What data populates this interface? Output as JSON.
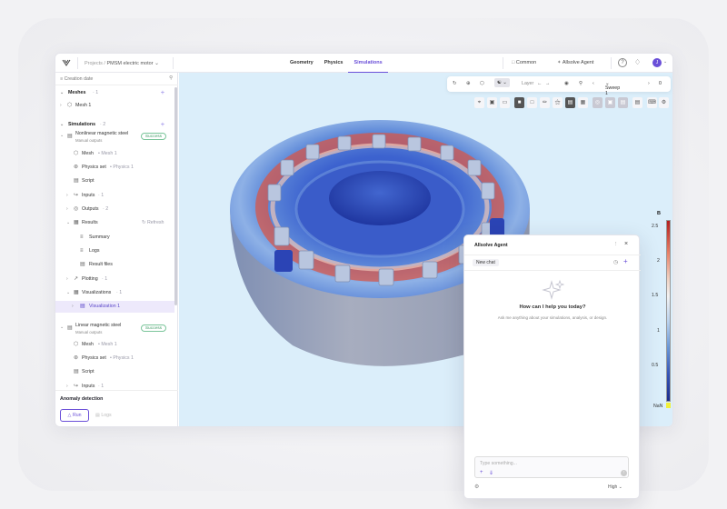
{
  "topbar": {
    "breadcrumb_root": "Projects",
    "breadcrumb_sep": "/",
    "project_name": "PMSM electric motor",
    "tabs": [
      {
        "label": "Geometry"
      },
      {
        "label": "Physics"
      },
      {
        "label": "Simulations"
      }
    ],
    "common_label": "Common",
    "agent_label": "Allsolve Agent",
    "help_icon": "help-circle-icon",
    "bell_icon": "bell-icon",
    "avatar_letter": "J"
  },
  "sidebar": {
    "filter_label": "Creation date",
    "meshes_label": "Meshes",
    "meshes_count": "· 1",
    "mesh_item": "Mesh 1",
    "simulations_label": "Simulations",
    "simulations_count": "· 2",
    "sim1": {
      "name": "Nonlinear magnetic steel",
      "subtitle": "Manual outputs",
      "status": "Success",
      "mesh_label": "Mesh",
      "mesh_ref": "Mesh 1",
      "physics_label": "Physics set",
      "physics_ref": "Physics 1",
      "script_label": "Script",
      "inputs_label": "Inputs",
      "inputs_count": "· 1",
      "outputs_label": "Outputs",
      "outputs_count": "· 2",
      "results_label": "Results",
      "refresh_label": "Refresh",
      "summary_label": "Summary",
      "logs_label": "Logs",
      "result_files_label": "Result files",
      "plotting_label": "Plotting",
      "plotting_count": "· 1",
      "visualizations_label": "Visualizations",
      "visualizations_count": "· 1",
      "visualization_item": "Visualization 1"
    },
    "sim2": {
      "name": "Linear magnetic steel",
      "subtitle": "Manual outputs",
      "status": "Success",
      "mesh_label": "Mesh",
      "mesh_ref": "Mesh 1",
      "physics_label": "Physics set",
      "physics_ref": "Physics 1",
      "script_label": "Script",
      "inputs_label": "Inputs",
      "inputs_count": "· 1"
    },
    "anomaly_title": "Anomaly detection",
    "run_label": "Run",
    "logs_button_label": "Logs"
  },
  "viewport": {
    "toolbar": {
      "layer_label": "Layer",
      "sweep_label": "Sweep 1",
      "sweep_value": "0"
    },
    "colorbar": {
      "title": "B",
      "ticks": [
        "2.5",
        "2",
        "1.5",
        "1",
        "0.5"
      ],
      "nan_label": "NaN",
      "nan_color": "#f1f03a"
    }
  },
  "chat": {
    "title": "Allsolve Agent",
    "new_chat_label": "New chat",
    "welcome": "How can I help you today?",
    "hint": "Ask me anything about your simulations, analysis, or design.",
    "input_placeholder": "Type something...",
    "effort_label": "High"
  },
  "colors": {
    "accent": "#6a4fd8",
    "success": "#3d9a64",
    "viewport_bg": "#dbeefa"
  }
}
